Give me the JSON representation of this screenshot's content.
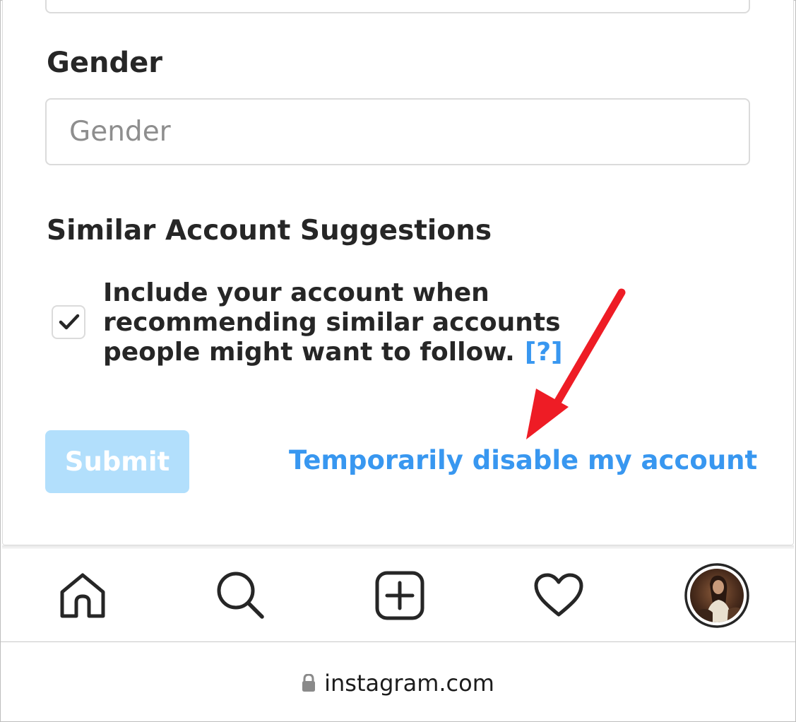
{
  "form": {
    "gender": {
      "label": "Gender",
      "placeholder": "Gender",
      "value": ""
    },
    "similar_accounts": {
      "heading": "Similar Account Suggestions",
      "checked": true,
      "description_lines": [
        "Include your account when",
        "recommending similar accounts",
        "people might want to follow."
      ],
      "help_link": "[?]"
    },
    "submit_label": "Submit",
    "disable_link": "Temporarily disable my account"
  },
  "annotation": {
    "arrow_color": "#ee1c25"
  },
  "nav": {
    "items": [
      {
        "name": "home",
        "icon": "home-icon"
      },
      {
        "name": "search",
        "icon": "search-icon"
      },
      {
        "name": "new-post",
        "icon": "add-post-icon"
      },
      {
        "name": "activity",
        "icon": "heart-icon"
      },
      {
        "name": "profile",
        "icon": "avatar"
      }
    ]
  },
  "browser": {
    "url": "instagram.com",
    "secure_icon": "lock-icon"
  },
  "colors": {
    "link_blue": "#3897f0",
    "submit_disabled_bg": "#b2dffc",
    "text_dark": "#262626",
    "border": "#dbdbdb"
  }
}
